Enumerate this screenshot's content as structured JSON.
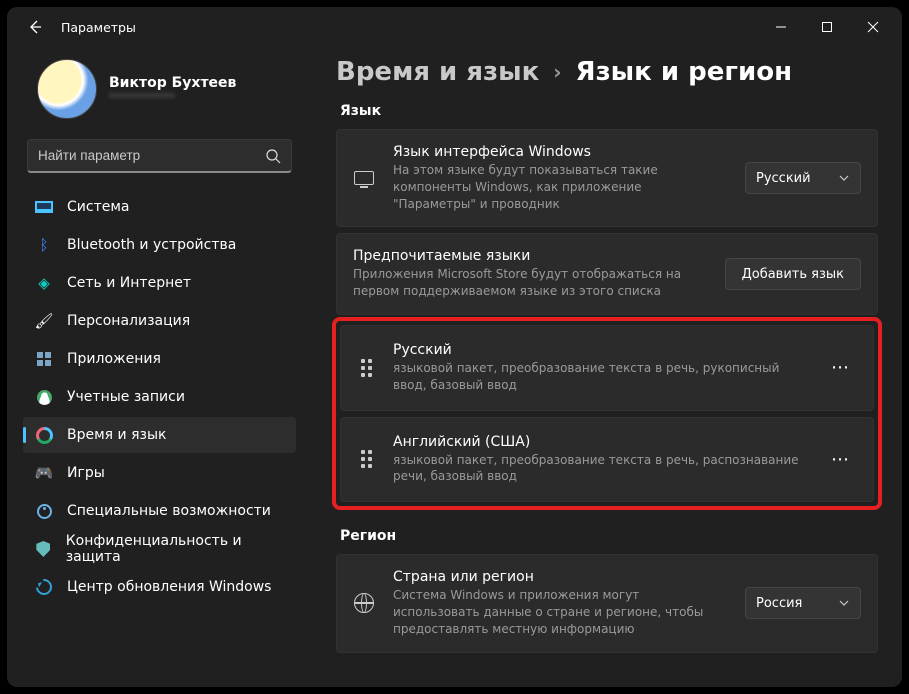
{
  "window": {
    "title": "Параметры"
  },
  "profile": {
    "name": "Виктор Бухтеев",
    "email": "************"
  },
  "search": {
    "placeholder": "Найти параметр"
  },
  "nav": [
    {
      "label": "Система"
    },
    {
      "label": "Bluetooth и устройства"
    },
    {
      "label": "Сеть и Интернет"
    },
    {
      "label": "Персонализация"
    },
    {
      "label": "Приложения"
    },
    {
      "label": "Учетные записи"
    },
    {
      "label": "Время и язык"
    },
    {
      "label": "Игры"
    },
    {
      "label": "Специальные возможности"
    },
    {
      "label": "Конфиденциальность и защита"
    },
    {
      "label": "Центр обновления Windows"
    }
  ],
  "breadcrumb": {
    "parent": "Время и язык",
    "current": "Язык и регион"
  },
  "sections": {
    "language_header": "Язык",
    "region_header": "Регион"
  },
  "display_language": {
    "title": "Язык интерфейса Windows",
    "subtitle": "На этом языке будут показываться такие компоненты Windows, как приложение \"Параметры\" и проводник",
    "selected": "Русский"
  },
  "preferred": {
    "title": "Предпочитаемые языки",
    "subtitle": "Приложения Microsoft Store будут отображаться на первом поддерживаемом языке из этого списка",
    "add_button": "Добавить язык"
  },
  "languages": [
    {
      "name": "Русский",
      "features": "языковой пакет, преобразование текста в речь, рукописный ввод, базовый ввод"
    },
    {
      "name": "Английский (США)",
      "features": "языковой пакет, преобразование текста в речь, распознавание речи, базовый ввод"
    }
  ],
  "region": {
    "title": "Страна или регион",
    "subtitle": "Система Windows и приложения могут использовать данные о стране и регионе, чтобы предоставлять местную информацию",
    "selected": "Россия"
  }
}
